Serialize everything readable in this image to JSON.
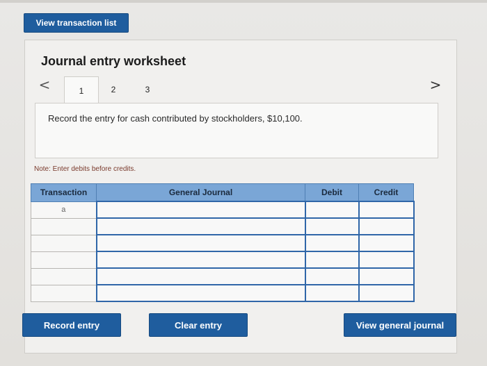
{
  "top_button": {
    "label": "View transaction list"
  },
  "worksheet": {
    "title": "Journal entry worksheet",
    "nav": {
      "prev": "<",
      "next": ">"
    },
    "tabs": [
      {
        "label": "1"
      },
      {
        "label": "2"
      },
      {
        "label": "3"
      }
    ],
    "prompt": "Record the entry for cash contributed by stockholders, $10,100.",
    "note": "Note: Enter debits before credits."
  },
  "journal": {
    "headers": {
      "transaction": "Transaction",
      "general_journal": "General Journal",
      "debit": "Debit",
      "credit": "Credit"
    },
    "rows": [
      {
        "transaction": "a",
        "account": "",
        "debit": "",
        "credit": ""
      },
      {
        "transaction": "",
        "account": "",
        "debit": "",
        "credit": ""
      },
      {
        "transaction": "",
        "account": "",
        "debit": "",
        "credit": ""
      },
      {
        "transaction": "",
        "account": "",
        "debit": "",
        "credit": ""
      },
      {
        "transaction": "",
        "account": "",
        "debit": "",
        "credit": ""
      },
      {
        "transaction": "",
        "account": "",
        "debit": "",
        "credit": ""
      }
    ]
  },
  "actions": {
    "record": "Record entry",
    "clear": "Clear entry",
    "view_journal": "View general journal"
  },
  "colors": {
    "button_bg": "#1f5d9e",
    "header_bg": "#7aa6d6",
    "field_border": "#2f66a8",
    "note_text": "#7a3a2c"
  }
}
